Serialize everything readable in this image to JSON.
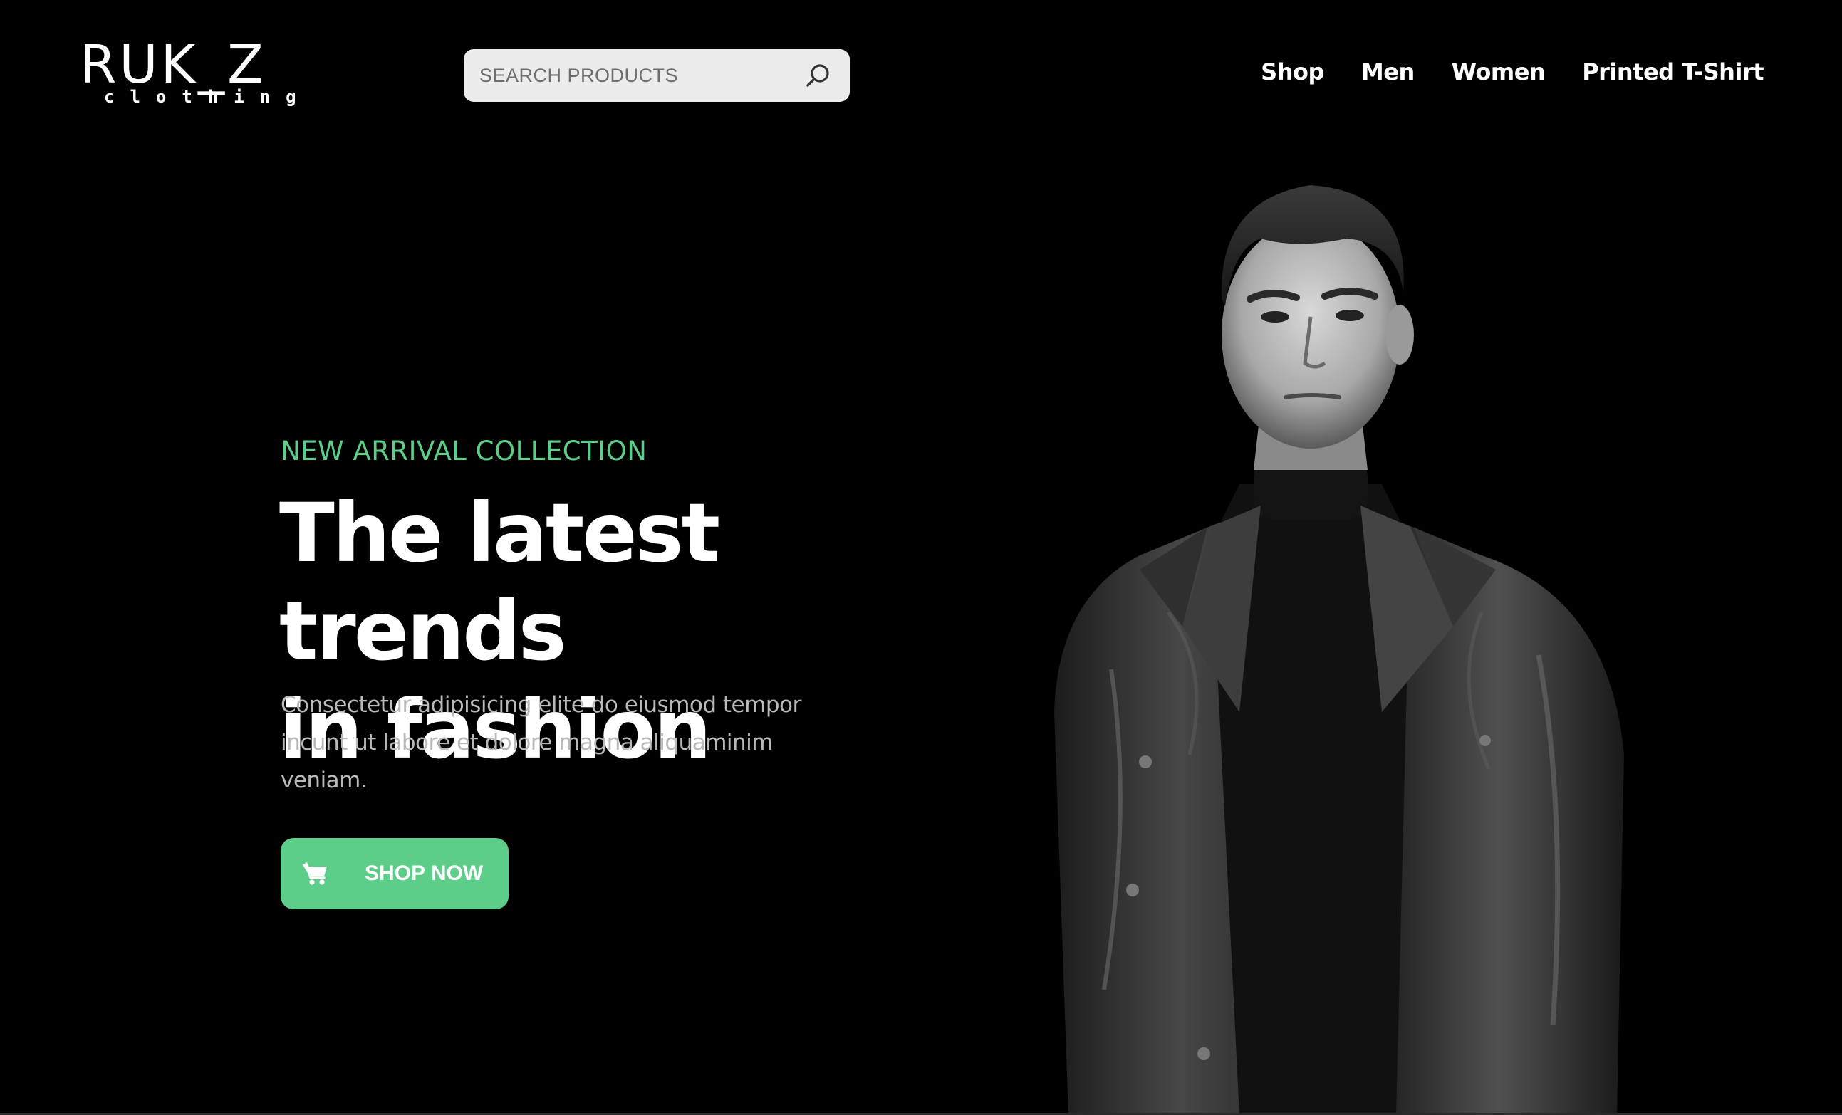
{
  "brand": {
    "logo_main": "RUK_Z",
    "logo_sub": "clothing"
  },
  "search": {
    "placeholder": "SEARCH PRODUCTS",
    "icon": "search-icon"
  },
  "nav": {
    "items": [
      {
        "label": "Shop"
      },
      {
        "label": "Men"
      },
      {
        "label": "Women"
      },
      {
        "label": "Printed T-Shirt"
      }
    ]
  },
  "hero": {
    "eyebrow": "NEW ARRIVAL COLLECTION",
    "headline_line1": "The latest trends",
    "headline_line2": "in fashion",
    "description_line1": "Consectetur adipisicing elite do eiusmod tempor",
    "description_line2": "incunt ut labore et dolore magna aliquaminim",
    "description_line3": "veniam.",
    "cta_label": "SHOP NOW",
    "cta_icon": "shopping-cart-icon",
    "image": "model-leather-jacket-photo"
  },
  "colors": {
    "background": "#000000",
    "accent": "#5dce8a",
    "text": "#ffffff",
    "muted_text": "#b9b9b9",
    "search_bg": "#ececec"
  }
}
